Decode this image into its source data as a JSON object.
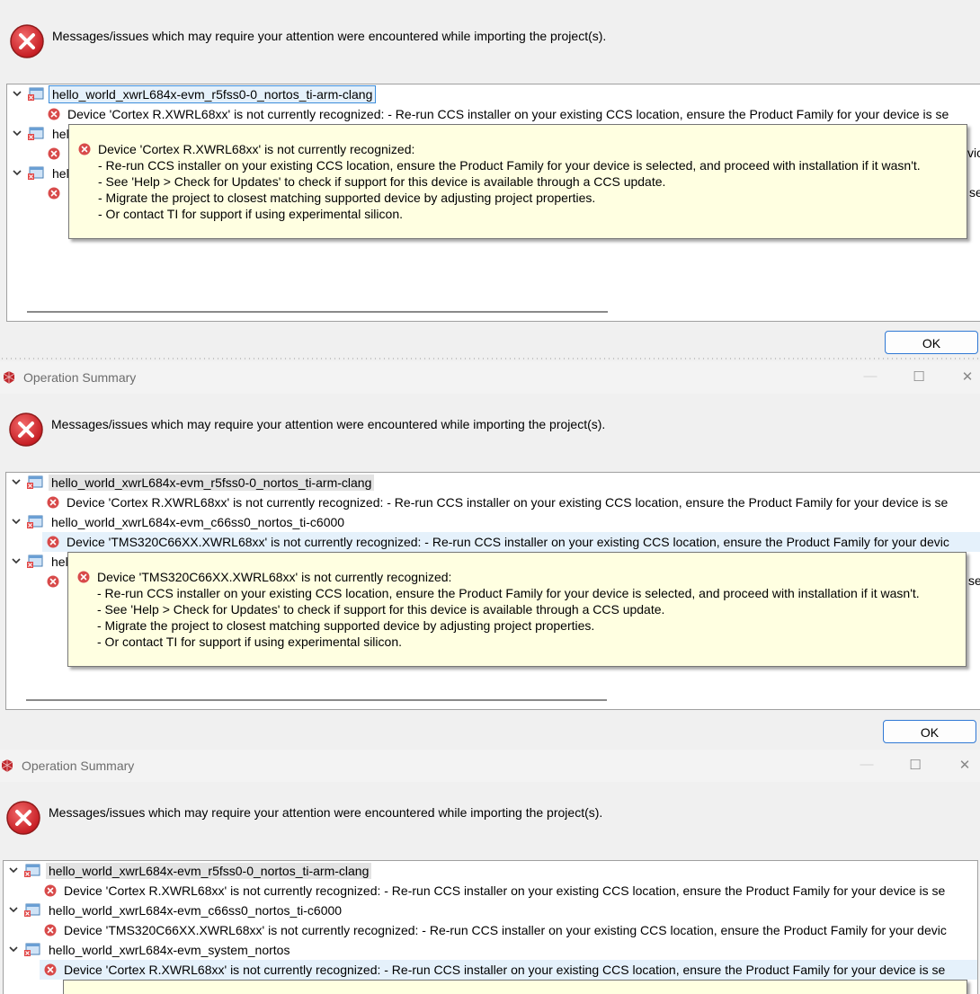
{
  "dialog_title": "Operation Summary",
  "message": "Messages/issues which may require your attention were encountered while importing the project(s).",
  "ok_label": "OK",
  "window_controls": {
    "minimize": "—",
    "maximize": "☐",
    "close": "✕"
  },
  "projects": [
    "hello_world_xwrL684x-evm_r5fss0-0_nortos_ti-arm-clang",
    "hello_world_xwrL684x-evm_c66ss0_nortos_ti-c6000",
    "hello_world_xwrL684x-evm_system_nortos"
  ],
  "truncated_project_prefix": "hel",
  "issues": {
    "cortex_short": "Device 'Cortex R.XWRL68xx' is not currently recognized: - Re-run CCS installer on your existing CCS location, ensure the Product Family for your device is se",
    "tms_short": "Device 'TMS320C66XX.XWRL68xx' is not currently recognized: - Re-run CCS installer on your existing CCS location, ensure the Product Family for your devic",
    "right_fragment_1": "vic",
    "right_fragment_2": "se"
  },
  "tooltip_cortex": {
    "heading": "Device 'Cortex R.XWRL68xx' is not currently recognized:",
    "lines": [
      "- Re-run CCS installer on your existing CCS location, ensure the Product Family for your device is selected, and proceed with installation if it wasn't.",
      "- See 'Help > Check for Updates' to check if support for this device is available through a CCS update.",
      "- Migrate the project to closest matching supported device by adjusting project properties.",
      "- Or contact TI for support if using experimental silicon."
    ]
  },
  "tooltip_tms": {
    "heading": "Device 'TMS320C66XX.XWRL68xx' is not currently recognized:",
    "lines": [
      "- Re-run CCS installer on your existing CCS location, ensure the Product Family for your device is selected, and proceed with installation if it wasn't.",
      "- See 'Help > Check for Updates' to check if support for this device is available through a CCS update.",
      "- Migrate the project to closest matching supported device by adjusting project properties.",
      "- Or contact TI for support if using experimental silicon."
    ]
  },
  "colors": {
    "error_red": "#d32f2f",
    "tooltip_bg": "#ffffe1",
    "selection": "#e5f1fb",
    "focus": "#2f78d4"
  }
}
